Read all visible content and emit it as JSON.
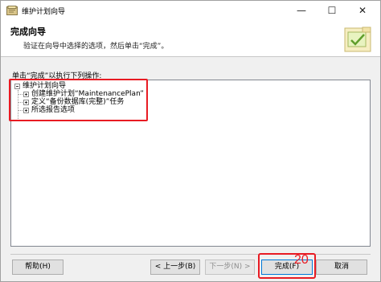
{
  "window": {
    "title": "维护计划向导",
    "minimize_glyph": "—",
    "maximize_glyph": "☐",
    "close_glyph": "✕"
  },
  "header": {
    "title": "完成向导",
    "subtitle": "验证在向导中选择的选项，然后单击“完成”。"
  },
  "main": {
    "section_label": "单击“完成”以执行下列操作:",
    "tree": {
      "root": "维护计划向导",
      "children": [
        "创建维护计划“MaintenancePlan”",
        "定义“备份数据库(完整)”任务",
        "所选报告选项"
      ]
    }
  },
  "buttons": {
    "help": "帮助(H)",
    "back": "< 上一步(B)",
    "next": "下一步(N) >",
    "finish": "完成(F)",
    "cancel": "取消"
  },
  "annotation": {
    "step_number": "20",
    "color": "#e81b23"
  }
}
